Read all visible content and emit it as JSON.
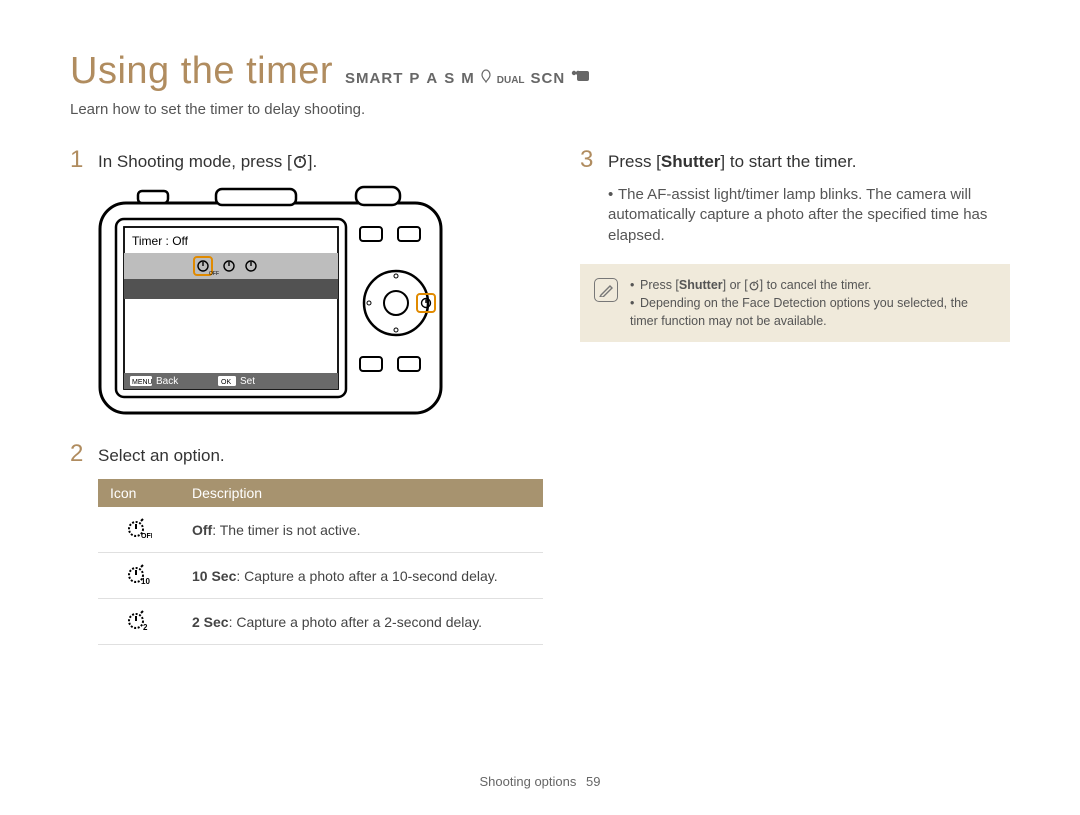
{
  "header": {
    "title": "Using the timer",
    "modes": [
      "SMART",
      "P",
      "A",
      "S",
      "M",
      "DUAL",
      "SCN"
    ],
    "subtitle": "Learn how to set the timer to delay shooting."
  },
  "left": {
    "step1_num": "1",
    "step1_a": "In Shooting mode, press [",
    "step1_b": "].",
    "camera_screen": {
      "label": "Timer : Off",
      "back_label": "Back",
      "set_label": "Set",
      "menu_btn": "MENU",
      "ok_btn": "OK"
    },
    "step2_num": "2",
    "step2_text": "Select an option.",
    "table": {
      "head_icon": "Icon",
      "head_desc": "Description",
      "rows": [
        {
          "icon_sub": "OFF",
          "bold": "Off",
          "rest": ": The timer is not active."
        },
        {
          "icon_sub": "10",
          "bold": "10 Sec",
          "rest": ": Capture a photo after a 10-second delay."
        },
        {
          "icon_sub": "2",
          "bold": "2 Sec",
          "rest": ": Capture a photo after a 2-second delay."
        }
      ]
    }
  },
  "right": {
    "step3_num": "3",
    "step3_a": "Press [",
    "step3_bold": "Shutter",
    "step3_b": "] to start the timer.",
    "bullet_a": "The AF-assist light/timer lamp blinks. The camera will automatically capture a photo after the specified time has elapsed.",
    "note_items": {
      "n1_a": "Press [",
      "n1_bold": "Shutter",
      "n1_b": "] or [",
      "n1_c": "] to cancel the timer.",
      "n2": "Depending on the Face Detection options you selected, the timer function may not be available."
    }
  },
  "footer": {
    "section": "Shooting options",
    "page": "59"
  }
}
